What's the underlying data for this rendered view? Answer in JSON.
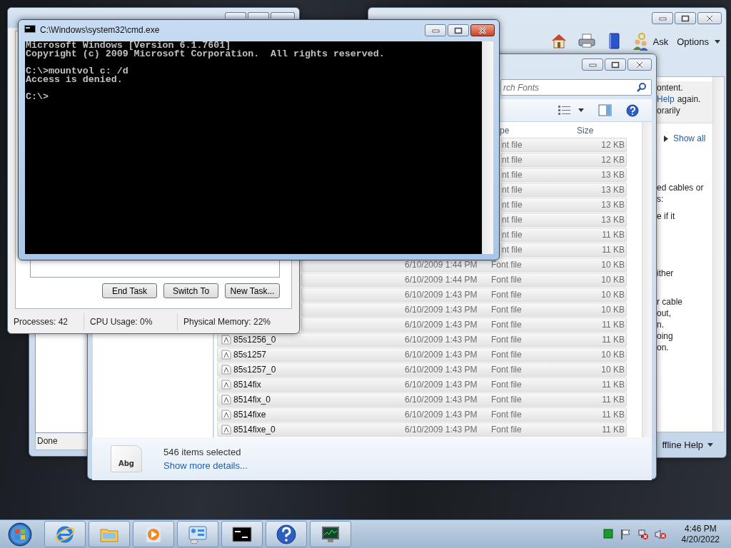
{
  "task_manager": {
    "active": false,
    "buttons": [
      "End Task",
      "Switch To",
      "New Task..."
    ],
    "status": [
      "Processes: 42",
      "CPU Usage: 0%",
      "Physical Memory: 22%"
    ]
  },
  "background_window": {
    "status": "Done"
  },
  "help_window": {
    "active": false,
    "toolbar": [
      {
        "kind": "home"
      },
      {
        "kind": "print"
      },
      {
        "kind": "browse"
      },
      {
        "kind": "ask",
        "label": "Ask"
      }
    ],
    "options_label": "Options",
    "notice": [
      {
        "text": "ontent."
      },
      {
        "link": "Help",
        "text": "again."
      },
      {
        "text": "orarily"
      }
    ],
    "show_all": "Show all",
    "lines": [
      "ed cables or",
      "s:",
      "e if it",
      "ither",
      "r cable",
      "out,",
      "n.",
      "oing",
      "on."
    ],
    "footer_label": "ffline Help"
  },
  "explorer": {
    "active": false,
    "search_placeholder": "rch Fonts",
    "columns": [
      "pe",
      "Size"
    ],
    "rows": [
      {
        "type": "nt file",
        "size": "12 KB",
        "selected": true
      },
      {
        "type": "nt file",
        "size": "12 KB",
        "selected": true
      },
      {
        "type": "nt file",
        "size": "13 KB",
        "selected": true
      },
      {
        "type": "nt file",
        "size": "13 KB",
        "selected": true
      },
      {
        "type": "nt file",
        "size": "13 KB",
        "selected": true
      },
      {
        "type": "nt file",
        "size": "13 KB",
        "selected": true
      },
      {
        "type": "nt file",
        "size": "11 KB",
        "selected": true
      },
      {
        "type": "nt file",
        "size": "11 KB",
        "selected": true
      },
      {
        "date": "6/10/2009 1:44 PM",
        "type": "Font file",
        "size": "10 KB",
        "selected": true
      },
      {
        "date": "6/10/2009 1:44 PM",
        "type": "Font file",
        "size": "10 KB",
        "selected": true
      },
      {
        "date": "6/10/2009 1:43 PM",
        "type": "Font file",
        "size": "10 KB",
        "selected": true
      },
      {
        "date": "6/10/2009 1:43 PM",
        "type": "Font file",
        "size": "10 KB",
        "selected": true
      },
      {
        "date": "6/10/2009 1:43 PM",
        "type": "Font file",
        "size": "11 KB",
        "selected": true
      },
      {
        "name": "85s1256_0",
        "date": "6/10/2009 1:43 PM",
        "type": "Font file",
        "size": "11 KB",
        "selected": true
      },
      {
        "name": "85s1257",
        "date": "6/10/2009 1:43 PM",
        "type": "Font file",
        "size": "10 KB",
        "selected": true
      },
      {
        "name": "85s1257_0",
        "date": "6/10/2009 1:43 PM",
        "type": "Font file",
        "size": "10 KB",
        "selected": true
      },
      {
        "name": "8514fix",
        "date": "6/10/2009 1:43 PM",
        "type": "Font file",
        "size": "11 KB",
        "selected": true
      },
      {
        "name": "8514fix_0",
        "date": "6/10/2009 1:43 PM",
        "type": "Font file",
        "size": "11 KB",
        "selected": true
      },
      {
        "name": "8514fixe",
        "date": "6/10/2009 1:43 PM",
        "type": "Font file",
        "size": "11 KB",
        "selected": true
      },
      {
        "name": "8514fixe_0",
        "date": "6/10/2009 1:43 PM",
        "type": "Font file",
        "size": "11 KB",
        "selected": true
      }
    ],
    "details": {
      "thumbnail_text": "Abg",
      "count": "546 items selected",
      "link": "Show more details..."
    }
  },
  "cmd": {
    "active": true,
    "title": "C:\\Windows\\system32\\cmd.exe",
    "blocks": [
      [
        "Microsoft Windows [Version 6.1.7601]",
        "Copyright (c) 2009 Microsoft Corporation.  All rights reserved."
      ],
      [
        "C:\\>mountvol c: /d",
        "Access is denied."
      ],
      [
        "C:\\>"
      ]
    ]
  },
  "taskbar": {
    "items": [
      {
        "kind": "browser"
      },
      {
        "kind": "folder"
      },
      {
        "kind": "media"
      },
      {
        "kind": "panel"
      },
      {
        "kind": "terminal"
      },
      {
        "kind": "help"
      },
      {
        "kind": "monitor"
      }
    ],
    "tray": [
      {
        "kind": "square"
      },
      {
        "kind": "flag"
      },
      {
        "kind": "network"
      },
      {
        "kind": "volume"
      }
    ],
    "time": "4:46 PM",
    "date": "4/20/2022"
  }
}
